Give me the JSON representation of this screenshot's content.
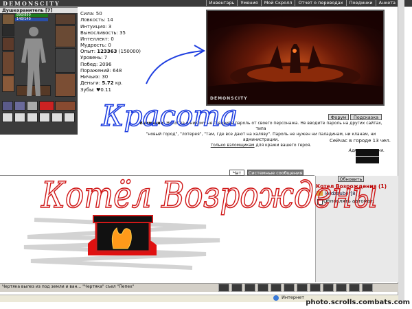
{
  "header": {
    "logo": "DEMONSCITY",
    "nav": [
      "Инвентарь",
      "Умения",
      "Мой Скролл",
      "Отчет о переводах",
      "Поединки",
      "Анкета"
    ]
  },
  "character": {
    "name": "Душехранитель",
    "level": "[7]",
    "hp": "890/890",
    "mp": "140/140"
  },
  "stats": [
    "Сила: 50",
    "Ловкость: 14",
    "Интуиция: 3",
    "Выносливость: 35",
    "Интеллект: 0",
    "Мудрость: 0"
  ],
  "progress": {
    "exp_label": "Опыт:",
    "exp_value": "123363",
    "exp_next": "(150000)",
    "level": "Уровень: 7",
    "wins": "Побед: 2096",
    "losses": "Поражений: 648",
    "draws": "Ничьих: 30",
    "money_label": "Деньги:",
    "money_value": "5.72",
    "money_unit": "кр.",
    "teeth": "Зубы: ♥0.11"
  },
  "scene": {
    "brand": "DEMONSCITY"
  },
  "buttons": {
    "forum": "Форум",
    "hint": "Подсказка",
    "refresh": "Обновить"
  },
  "notice": {
    "bold": "Внимание!",
    "line1": " Никогда и никому не говорите пароль от своего персонажа. Не вводите пароль на других сайтах, типа",
    "line2": "\"новый город\", \"лотерея\", \"там, где все дают на халяву\". Пароль не нужен ни паладинам, ни кланам, ни администрации,",
    "link": "только взломщикам",
    "line3": " для кражи вашего героя.",
    "sign": "Администрация."
  },
  "online": "Сейчас в городе 13 чел.",
  "tabs": {
    "chat": "Чат",
    "system": "Системные сообщения"
  },
  "room": {
    "title": "Котел Возрождения (1)",
    "user": "lordzauber[8]",
    "auto": "Обновлять автомат."
  },
  "handwriting": {
    "top": "Красота",
    "bottom": "Котёл Возрождены"
  },
  "message_bar": "Чертяка вылез из под земли и ван... \"Чертяка\" съел \"Пепех\"",
  "statusbar": {
    "zone": "Интернет"
  },
  "watermark": "photo.scrolls.combats.com",
  "colors": {
    "panel": "#3c3c3c",
    "accent_red": "#d01818",
    "pen_blue": "#1f3fe0"
  }
}
